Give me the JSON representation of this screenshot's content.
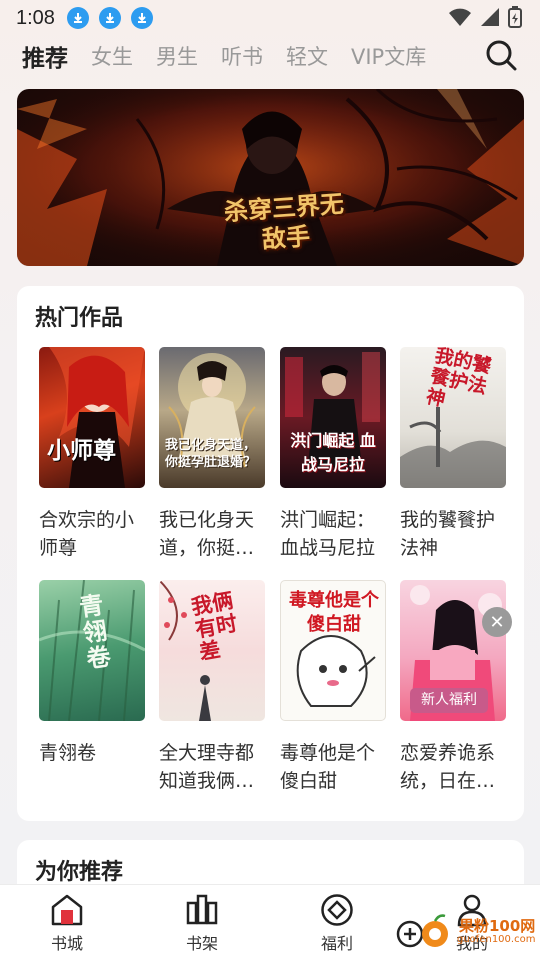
{
  "status_bar": {
    "time": "1:08",
    "icons": [
      "download-icon",
      "download-icon",
      "download-icon",
      "wifi-icon",
      "signal-icon",
      "battery-charging-icon"
    ]
  },
  "nav": {
    "tabs": [
      {
        "label": "推荐",
        "active": true
      },
      {
        "label": "女生",
        "active": false
      },
      {
        "label": "男生",
        "active": false
      },
      {
        "label": "听书",
        "active": false
      },
      {
        "label": "轻文",
        "active": false
      },
      {
        "label": "VIP文库",
        "active": false
      }
    ],
    "search_icon": "search-icon"
  },
  "banner": {
    "title": "杀穿三界无敌手"
  },
  "hot": {
    "title": "热门作品",
    "books": [
      {
        "title": "合欢宗的小师尊",
        "cover_text": "小师尊"
      },
      {
        "title": "我已化身天道，你挺…",
        "cover_text": "我已化身天道，你挺孕肚退婚？"
      },
      {
        "title": "洪门崛起：血战马尼拉",
        "cover_text": "洪门崛起 血战马尼拉"
      },
      {
        "title": "我的饕餮护法神",
        "cover_text": "我的饕餮护法神"
      },
      {
        "title": "青翎卷",
        "cover_text": "青翎卷"
      },
      {
        "title": "全大理寺都知道我俩…",
        "cover_text": "我俩有时差"
      },
      {
        "title": "毒尊他是个傻白甜",
        "cover_text": "毒尊他是个傻白甜"
      },
      {
        "title": "恋爱养诡系统，日在…",
        "cover_text": ""
      }
    ],
    "welfare_badge": "新人福利"
  },
  "recommend": {
    "title": "为你推荐"
  },
  "bottom_nav": {
    "items": [
      {
        "label": "书城",
        "icon": "home-icon",
        "active": true
      },
      {
        "label": "书架",
        "icon": "bookshelf-icon",
        "active": false
      },
      {
        "label": "福利",
        "icon": "diamond-icon",
        "active": false
      },
      {
        "label": "我的",
        "icon": "user-icon",
        "active": false
      }
    ]
  },
  "watermark": {
    "text": "果粉100网",
    "sub": "guofen100.com"
  },
  "colors": {
    "accent_red": "#e0323c",
    "download_blue": "#2d9cf0",
    "welfare_pink": "#c85a8a",
    "text_dark": "#222222",
    "text_muted": "#999999"
  }
}
